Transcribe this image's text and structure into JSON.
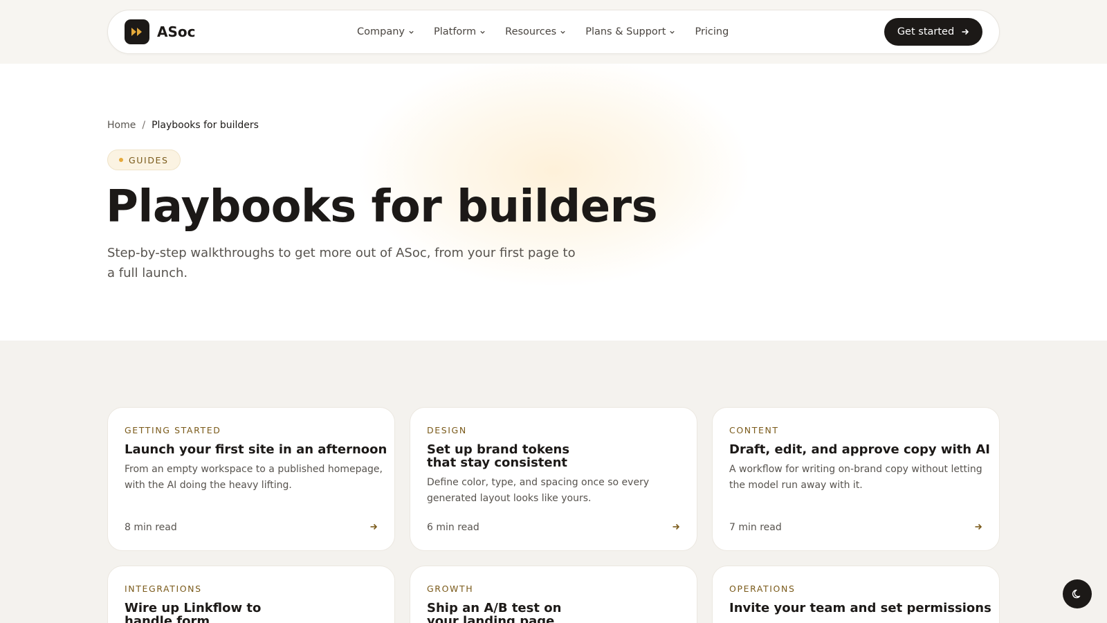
{
  "brand": {
    "name": "ASoc"
  },
  "nav": {
    "items": [
      {
        "label": "Company",
        "has_dropdown": true
      },
      {
        "label": "Platform",
        "has_dropdown": true
      },
      {
        "label": "Resources",
        "has_dropdown": true
      },
      {
        "label": "Plans & Support",
        "has_dropdown": true
      },
      {
        "label": "Pricing",
        "has_dropdown": false
      }
    ],
    "cta_label": "Get started"
  },
  "breadcrumb": {
    "home": "Home",
    "separator": "/",
    "current": "Playbooks for builders"
  },
  "hero": {
    "tag": "GUIDES",
    "title": "Playbooks for builders",
    "subtitle": "Step-by-step walkthroughs to get more out of ASoc, from your first page to a full launch."
  },
  "cards": [
    {
      "category": "GETTING STARTED",
      "title": "Launch your first site in an afternoon",
      "description": "From an empty workspace to a published homepage, with the AI doing the heavy lifting.",
      "read_time": "8 min read"
    },
    {
      "category": "DESIGN",
      "title": "Set up brand tokens that stay consistent",
      "description": "Define color, type, and spacing once so every generated layout looks like yours.",
      "read_time": "6 min read"
    },
    {
      "category": "CONTENT",
      "title": "Draft, edit, and approve copy with AI",
      "description": "A workflow for writing on-brand copy without letting the model run away with it.",
      "read_time": "7 min read"
    },
    {
      "category": "INTEGRATIONS",
      "title": "Wire up Linkflow to handle form submissions",
      "description": "",
      "read_time": ""
    },
    {
      "category": "GROWTH",
      "title": "Ship an A/B test on your landing page",
      "description": "",
      "read_time": ""
    },
    {
      "category": "OPERATIONS",
      "title": "Invite your team and set permissions",
      "description": "",
      "read_time": ""
    }
  ],
  "colors": {
    "accent": "#e5a93b",
    "category_text": "#7a5a1a",
    "dark": "#1c1917",
    "section_bg": "#f4f2ee"
  },
  "icons": {
    "logo": "fast-forward-icon",
    "dropdown": "chevron-down-icon",
    "cta": "arrow-right-icon",
    "card": "arrow-right-icon",
    "theme_toggle": "moon-icon"
  }
}
